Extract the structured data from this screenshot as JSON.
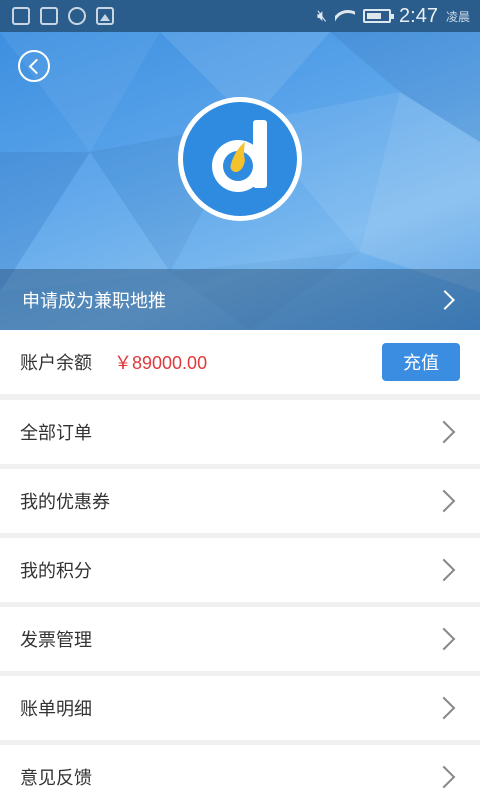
{
  "status_bar": {
    "time": "2:47",
    "period": "凌晨",
    "icons": [
      "sim-icon",
      "sim-icon",
      "app-icon",
      "image-icon",
      "mute-icon",
      "wifi-icon",
      "battery-icon"
    ]
  },
  "header": {
    "back_icon": "back-circle-icon",
    "logo_icon": "d-logo",
    "apply_label": "申请成为兼职地推"
  },
  "balance": {
    "label": "账户余额",
    "value": "￥89000.00",
    "recharge_label": "充值"
  },
  "menu": {
    "items": [
      {
        "label": "全部订单"
      },
      {
        "label": "我的优惠券"
      },
      {
        "label": "我的积分"
      },
      {
        "label": "发票管理"
      },
      {
        "label": "账单明细"
      },
      {
        "label": "意见反馈"
      }
    ]
  },
  "colors": {
    "accent": "#3a8de0",
    "price": "#e0393b",
    "logo_yellow": "#f5c22c"
  }
}
